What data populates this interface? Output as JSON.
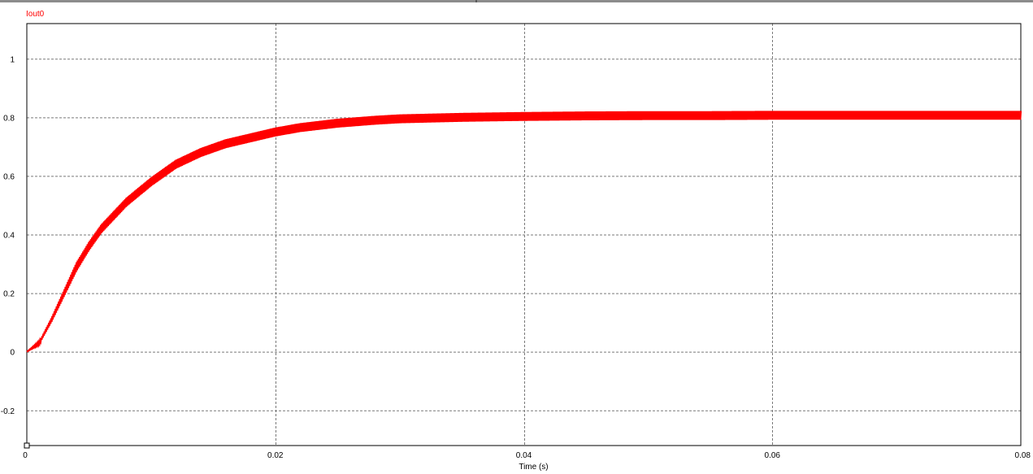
{
  "chart_data": {
    "type": "line",
    "title": "",
    "xlabel": "Time (s)",
    "ylabel": "",
    "xlim": [
      0,
      0.08
    ],
    "ylim": [
      -0.32,
      1.12
    ],
    "grid": true,
    "grid_style": "dashed",
    "x_ticks": [
      0,
      0.02,
      0.04,
      0.06,
      0.08
    ],
    "x_tick_labels": [
      "0",
      "0.02",
      "0.04",
      "0.06",
      "0.08"
    ],
    "y_ticks": [
      -0.2,
      0,
      0.2,
      0.4,
      0.6,
      0.8,
      1
    ],
    "y_tick_labels": [
      "-0.2",
      "0",
      "0.2",
      "0.4",
      "0.6",
      "0.8",
      "1"
    ],
    "series": [
      {
        "name": "Iout0",
        "color": "#ff0000",
        "x": [
          0,
          0.001,
          0.002,
          0.003,
          0.004,
          0.005,
          0.006,
          0.008,
          0.01,
          0.012,
          0.014,
          0.016,
          0.018,
          0.02,
          0.022,
          0.025,
          0.028,
          0.03,
          0.035,
          0.04,
          0.045,
          0.05,
          0.055,
          0.06,
          0.065,
          0.07,
          0.075,
          0.08
        ],
        "y": [
          0,
          0.03,
          0.11,
          0.2,
          0.29,
          0.36,
          0.42,
          0.51,
          0.58,
          0.64,
          0.68,
          0.71,
          0.73,
          0.75,
          0.765,
          0.78,
          0.79,
          0.795,
          0.8,
          0.803,
          0.805,
          0.806,
          0.806,
          0.807,
          0.807,
          0.807,
          0.807,
          0.807
        ],
        "ripple_amplitude": 0.015
      }
    ]
  }
}
